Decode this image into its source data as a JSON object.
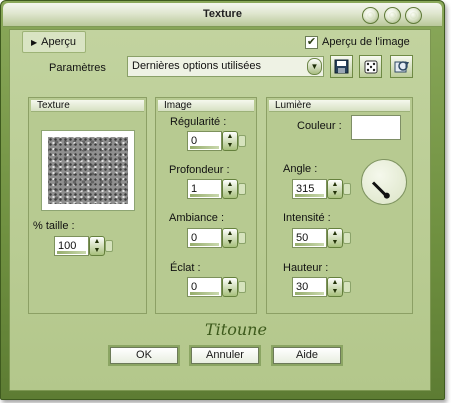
{
  "window": {
    "title": "Texture"
  },
  "preview": {
    "tab_label": "Aperçu",
    "checkbox_label": "Aperçu de l'image",
    "checkbox_checked": true
  },
  "params": {
    "label": "Paramètres",
    "selected": "Dernières options utilisées"
  },
  "groups": {
    "texture": {
      "title": "Texture",
      "size_label": "% taille :",
      "size_value": "100"
    },
    "image": {
      "title": "Image",
      "regularite_label": "Régularité :",
      "regularite_value": "0",
      "profondeur_label": "Profondeur :",
      "profondeur_value": "1",
      "ambiance_label": "Ambiance :",
      "ambiance_value": "0",
      "eclat_label": "Éclat :",
      "eclat_value": "0"
    },
    "lumiere": {
      "title": "Lumière",
      "couleur_label": "Couleur :",
      "couleur_value": "#ffffff",
      "angle_label": "Angle :",
      "angle_value": "315",
      "intensite_label": "Intensité :",
      "intensite_value": "50",
      "hauteur_label": "Hauteur :",
      "hauteur_value": "30"
    }
  },
  "signature": "Titoune",
  "buttons": {
    "ok": "OK",
    "annuler": "Annuler",
    "aide": "Aide"
  },
  "colors": {
    "frame": "#6f9040",
    "client": "#b3c78b"
  }
}
